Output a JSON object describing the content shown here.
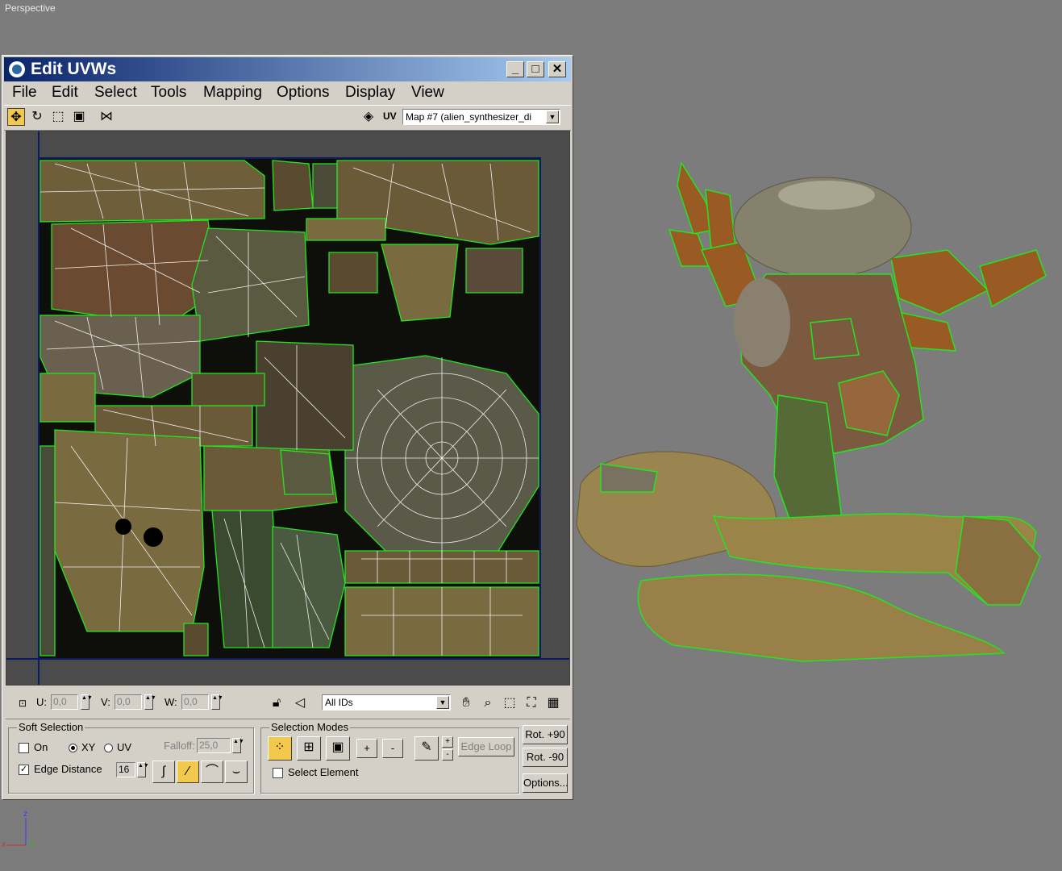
{
  "viewport": {
    "label": "Perspective",
    "axis_labels": {
      "x": "x",
      "y": "y",
      "z": "z"
    }
  },
  "window": {
    "title": "Edit UVWs",
    "controls": {
      "minimize": "_",
      "maximize": "□",
      "close": "✕"
    }
  },
  "menu": [
    "File",
    "Edit",
    "Select",
    "Tools",
    "Mapping",
    "Options",
    "Display",
    "View"
  ],
  "toolbar": {
    "tools": [
      "move-tool",
      "rotate-tool",
      "scale-tool",
      "freeform-tool",
      "mirror-tool"
    ],
    "uv_label": "UV",
    "map_select": "Map #7 (alien_synthesizer_di"
  },
  "coords": {
    "u_label": "U:",
    "u_value": "0,0",
    "v_label": "V:",
    "v_value": "0,0",
    "w_label": "W:",
    "w_value": "0,0",
    "ids_select": "All IDs"
  },
  "soft_selection": {
    "title": "Soft Selection",
    "on_label": "On",
    "xy_label": "XY",
    "uv_label": "UV",
    "falloff_label": "Falloff:",
    "falloff_value": "25,0",
    "edge_distance_label": "Edge Distance",
    "edge_distance_value": "16"
  },
  "selection_modes": {
    "title": "Selection Modes",
    "plus_label": "+",
    "minus_label": "-",
    "edge_loop_label": "Edge Loop",
    "select_element_label": "Select Element"
  },
  "side_buttons": {
    "rot_plus": "Rot. +90",
    "rot_minus": "Rot. -90",
    "options": "Options..."
  },
  "colors": {
    "viewport_bg": "#7c7c7c",
    "dialog_bg": "#d4d0c8",
    "seam_green": "#22e61e",
    "active_yellow": "#f2c94c"
  }
}
